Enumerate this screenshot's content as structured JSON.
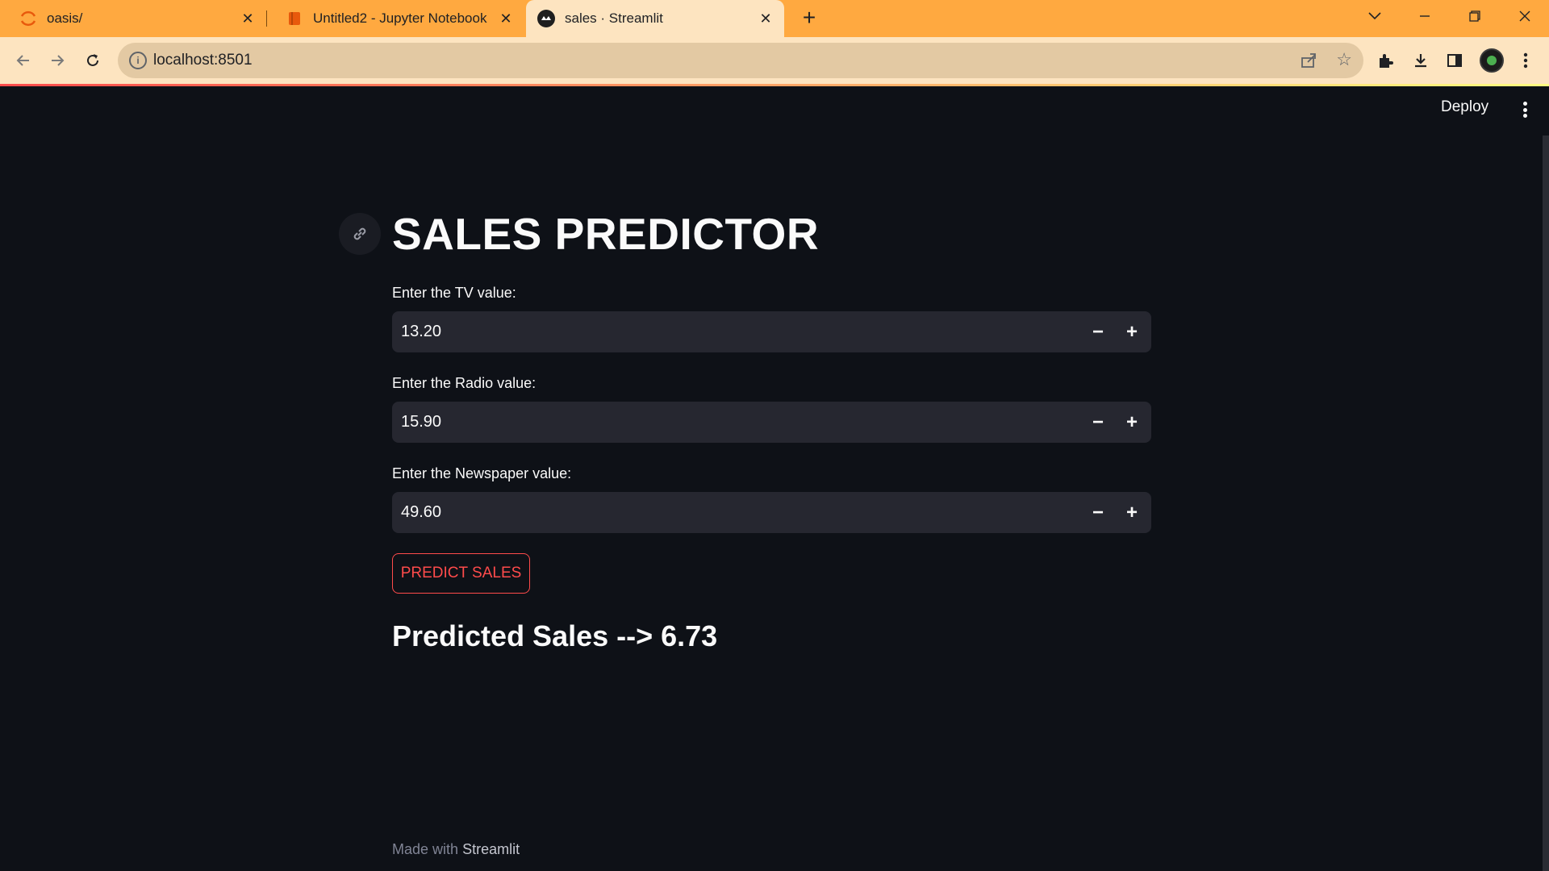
{
  "browser": {
    "tabs": [
      {
        "title": "oasis/",
        "icon": "jupyter-spinner-icon"
      },
      {
        "title": "Untitled2 - Jupyter Notebook",
        "icon": "jupyter-notebook-icon"
      },
      {
        "title": "sales · Streamlit",
        "icon": "streamlit-icon",
        "active": true
      }
    ],
    "new_tab_symbol": "+",
    "url": "localhost:8501"
  },
  "app": {
    "deploy_label": "Deploy",
    "title": "SALES PREDICTOR",
    "inputs": [
      {
        "label": "Enter the TV value:",
        "value": "13.20"
      },
      {
        "label": "Enter the Radio value:",
        "value": "15.90"
      },
      {
        "label": "Enter the Newspaper value:",
        "value": "49.60"
      }
    ],
    "button_label": "PREDICT SALES",
    "result": "Predicted Sales --> 6.73",
    "footer_prefix": "Made with",
    "footer_brand": "Streamlit"
  },
  "colors": {
    "tabstrip": "#ffa940",
    "toolbar": "#fde4c0",
    "app_bg": "#0e1117",
    "input_bg": "#262730",
    "accent": "#ff4b4b"
  }
}
